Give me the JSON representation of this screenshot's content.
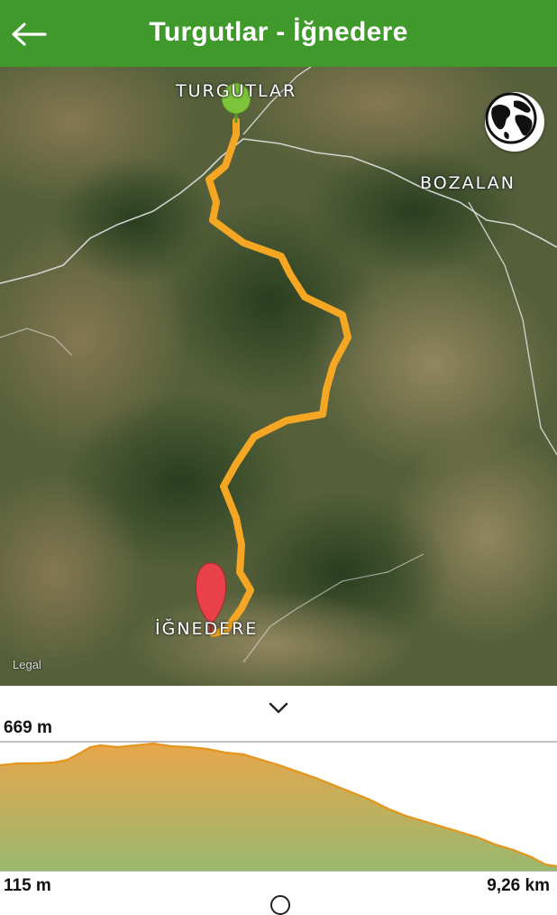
{
  "header": {
    "title": "Turgutlar - İğnedere",
    "back_icon": "arrow-left-icon"
  },
  "map": {
    "labels": {
      "turgutlar": "TURGUTLAR",
      "bozalan": "BOZALAN",
      "ignedere": "İĞNEDERE"
    },
    "legal": "Legal",
    "route_color": "#f5a623",
    "start_marker_color": "#7dc43b",
    "end_marker_color": "#e8414a",
    "map_type_icon": "globe-icon"
  },
  "elevation": {
    "max_label": "669 m",
    "min_label": "115 m",
    "distance_label": "9,26 km",
    "collapse_icon": "chevron-down-icon",
    "fill_top_color": "#e8a64a",
    "fill_bottom_color": "#9ab86f",
    "line_color": "#e3951c"
  }
}
